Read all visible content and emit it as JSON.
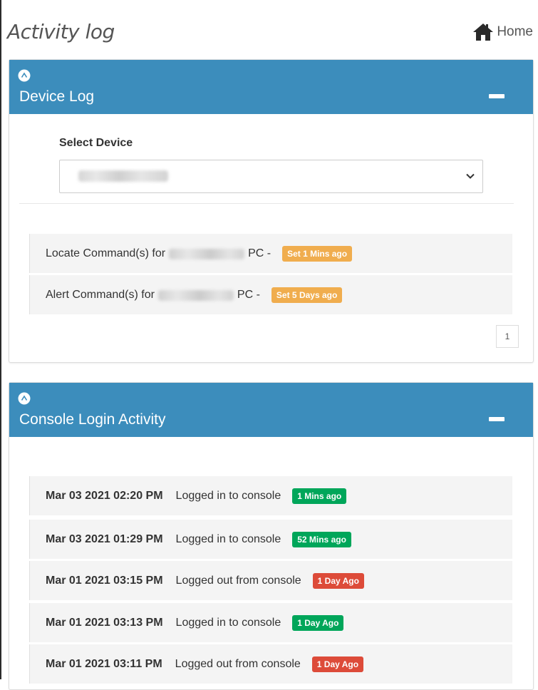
{
  "page": {
    "title": "Activity log",
    "home_label": "Home"
  },
  "device_log": {
    "title": "Device Log",
    "select_label": "Select Device",
    "commands": [
      {
        "prefix": "Locate Command(s) for",
        "suffix": "PC -",
        "badge": "Set 1 Mins ago",
        "badge_color": "#f0ad4e"
      },
      {
        "prefix": "Alert Command(s) for",
        "suffix": "PC -",
        "badge": "Set 5 Days ago",
        "badge_color": "#f0ad4e"
      }
    ],
    "pagination": {
      "current_page": "1"
    }
  },
  "console_activity": {
    "title": "Console Login Activity",
    "rows": [
      {
        "date": "Mar 03 2021 02:20 PM",
        "action": "Logged in to console",
        "badge": "1 Mins ago",
        "status": "success"
      },
      {
        "date": "Mar 03 2021 01:29 PM",
        "action": "Logged in to console",
        "badge": "52 Mins ago",
        "status": "success"
      },
      {
        "date": "Mar 01 2021 03:15 PM",
        "action": "Logged out from console",
        "badge": "1 Day Ago",
        "status": "danger"
      },
      {
        "date": "Mar 01 2021 03:13 PM",
        "action": "Logged in to console",
        "badge": "1 Day Ago",
        "status": "success"
      },
      {
        "date": "Mar 01 2021 03:11 PM",
        "action": "Logged out from console",
        "badge": "1 Day Ago",
        "status": "danger"
      }
    ]
  },
  "colors": {
    "panel_header": "#3c8dbc",
    "warning": "#f0ad4e",
    "success": "#00a65a",
    "danger": "#dd4b39"
  },
  "icons": {
    "home": "home-icon",
    "collapse": "minus-icon",
    "panel_badge": "chevron-up-circle-icon",
    "select_caret": "chevron-down-icon"
  }
}
